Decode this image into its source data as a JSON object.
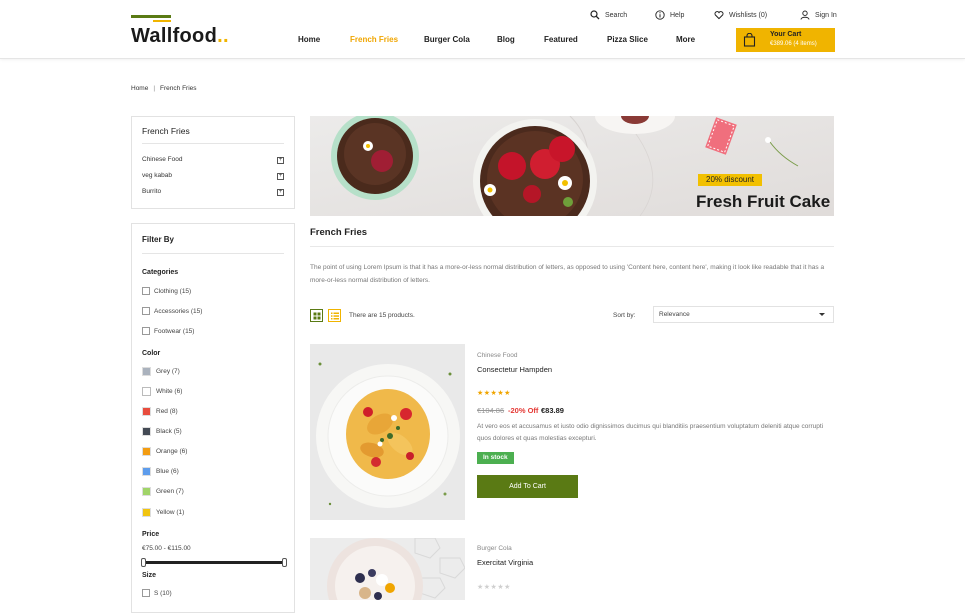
{
  "header": {
    "logo_text": "Wallfood",
    "logo_dots": "..",
    "top_links": {
      "search": "Search",
      "help": "Help",
      "wishlists": "Wishlists (0)",
      "sign_in": "Sign In"
    },
    "nav": [
      "Home",
      "French Fries",
      "Burger Cola",
      "Blog",
      "Featured",
      "Pizza Slice",
      "More"
    ],
    "active_nav": "French Fries",
    "cart": {
      "title": "Your Cart",
      "summary": "€389.06 (4 items)"
    }
  },
  "breadcrumb": {
    "home": "Home",
    "separator": "|",
    "current": "French Fries"
  },
  "category_box": {
    "title": "French Fries",
    "items": [
      "Chinese Food",
      "veg kabab",
      "Burrito"
    ]
  },
  "filter": {
    "title": "Filter By",
    "categories_heading": "Categories",
    "categories": [
      "Clothing (15)",
      "Accessories (15)",
      "Footwear (15)"
    ],
    "color_heading": "Color",
    "colors": [
      {
        "label": "Grey (7)",
        "hex": "#aab2bd"
      },
      {
        "label": "White (6)",
        "hex": "#ffffff"
      },
      {
        "label": "Red (8)",
        "hex": "#e84c3d"
      },
      {
        "label": "Black (5)",
        "hex": "#434a54"
      },
      {
        "label": "Orange (6)",
        "hex": "#f39c11"
      },
      {
        "label": "Blue (6)",
        "hex": "#5d9cec"
      },
      {
        "label": "Green (7)",
        "hex": "#a0d468"
      },
      {
        "label": "Yellow (1)",
        "hex": "#f1c40f"
      }
    ],
    "price_heading": "Price",
    "price_range": "€75.00 - €115.00",
    "size_heading": "Size",
    "sizes": [
      "S (10)"
    ]
  },
  "banner": {
    "badge": "20% discount",
    "headline": "Fresh Fruit Cake"
  },
  "section": {
    "title": "French Fries",
    "description": "The point of using Lorem Ipsum is that it has a more-or-less normal distribution of letters, as opposed to using 'Content here, content here', making it look like readable that it has a more-or-less normal distribution of letters."
  },
  "toolbar": {
    "count": "There are 15 products.",
    "sort_label": "Sort by:",
    "sort_value": "Relevance"
  },
  "products": [
    {
      "category": "Chinese Food",
      "name": "Consectetur Hampden",
      "stars": "★★★★★",
      "old_price": "€104.86",
      "discount": "-20% Off",
      "price": "€83.89",
      "description": "At vero eos et accusamus et iusto odio dignissimos ducimus qui blanditiis praesentium voluptatum deleniti atque corrupti quos dolores et quas molestias excepturi.",
      "stock": "In stock",
      "button": "Add To Cart"
    },
    {
      "category": "Burger Cola",
      "name": "Exercitat Virginia",
      "stars": "★★★★★"
    }
  ],
  "colors": {
    "accent": "#f0b400",
    "brand_green": "#5a7a14",
    "sale_red": "#e53935",
    "stock_green": "#4caf50"
  }
}
